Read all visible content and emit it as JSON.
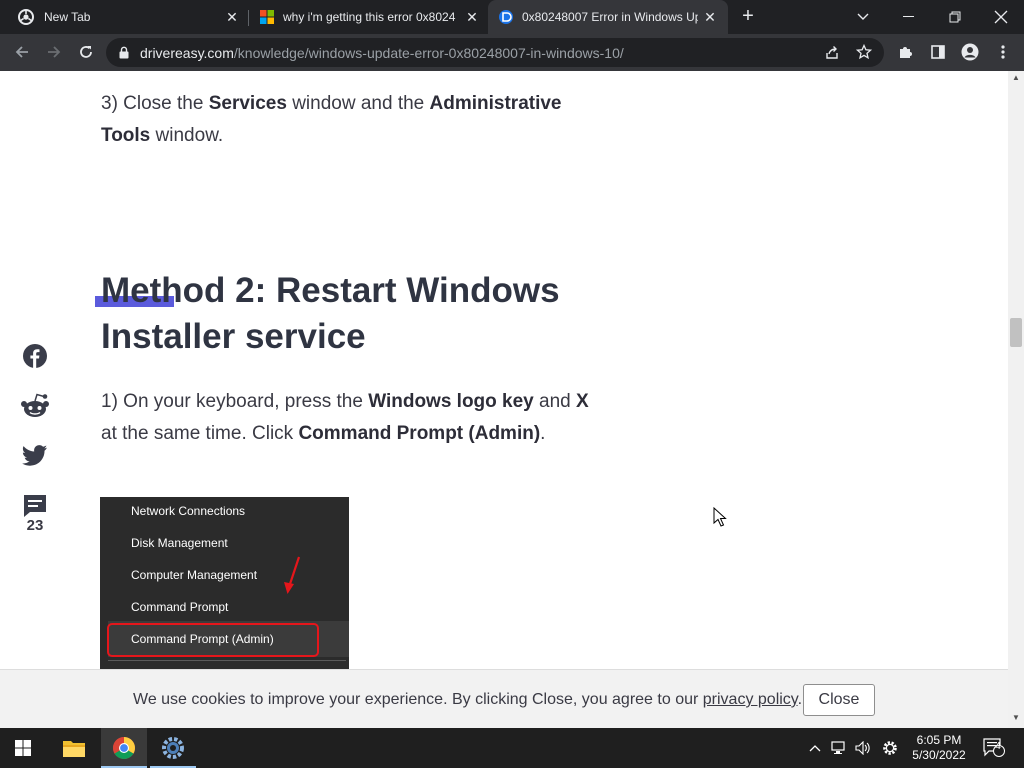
{
  "browser": {
    "tabs": [
      {
        "title": "New Tab",
        "favicon": "chrome-icon"
      },
      {
        "title": "why i'm getting this error 0x8024",
        "favicon": "microsoft-icon"
      },
      {
        "title": "0x80248007 Error in Windows Up",
        "favicon": "drivereasy-icon"
      }
    ],
    "url_host": "drivereasy.com",
    "url_path": "/knowledge/windows-update-error-0x80248007-in-windows-10/"
  },
  "article": {
    "step3": {
      "prefix": "3) Close the ",
      "b1": "Services",
      "mid": " window and the ",
      "b2": "Administrative Tools",
      "suffix": " window."
    },
    "heading": "Method 2: Restart Windows Installer service",
    "step1": {
      "prefix": "1) On your keyboard, press the ",
      "b1": "Windows logo key",
      "mid1": " and ",
      "b2": "X",
      "mid2": " at the same time. Click ",
      "b3": "Command Prompt (Admin)",
      "suffix": "."
    },
    "menu_items": [
      "Network Connections",
      "Disk Management",
      "Computer Management",
      "Command Prompt",
      "Command Prompt (Admin)"
    ]
  },
  "share": {
    "comments_count": "23"
  },
  "cookie": {
    "text": "We use cookies to improve your experience. By clicking Close, you agree to our ",
    "link": "privacy policy",
    "end": ".",
    "button": "Close"
  },
  "taskbar": {
    "time": "6:05 PM",
    "date": "5/30/2022",
    "notifications": "4"
  },
  "colors": {
    "accent": "#5b5bdc",
    "highlight_box": "#e5161b",
    "tab_bg": "#202124",
    "toolbar_bg": "#35363a"
  }
}
